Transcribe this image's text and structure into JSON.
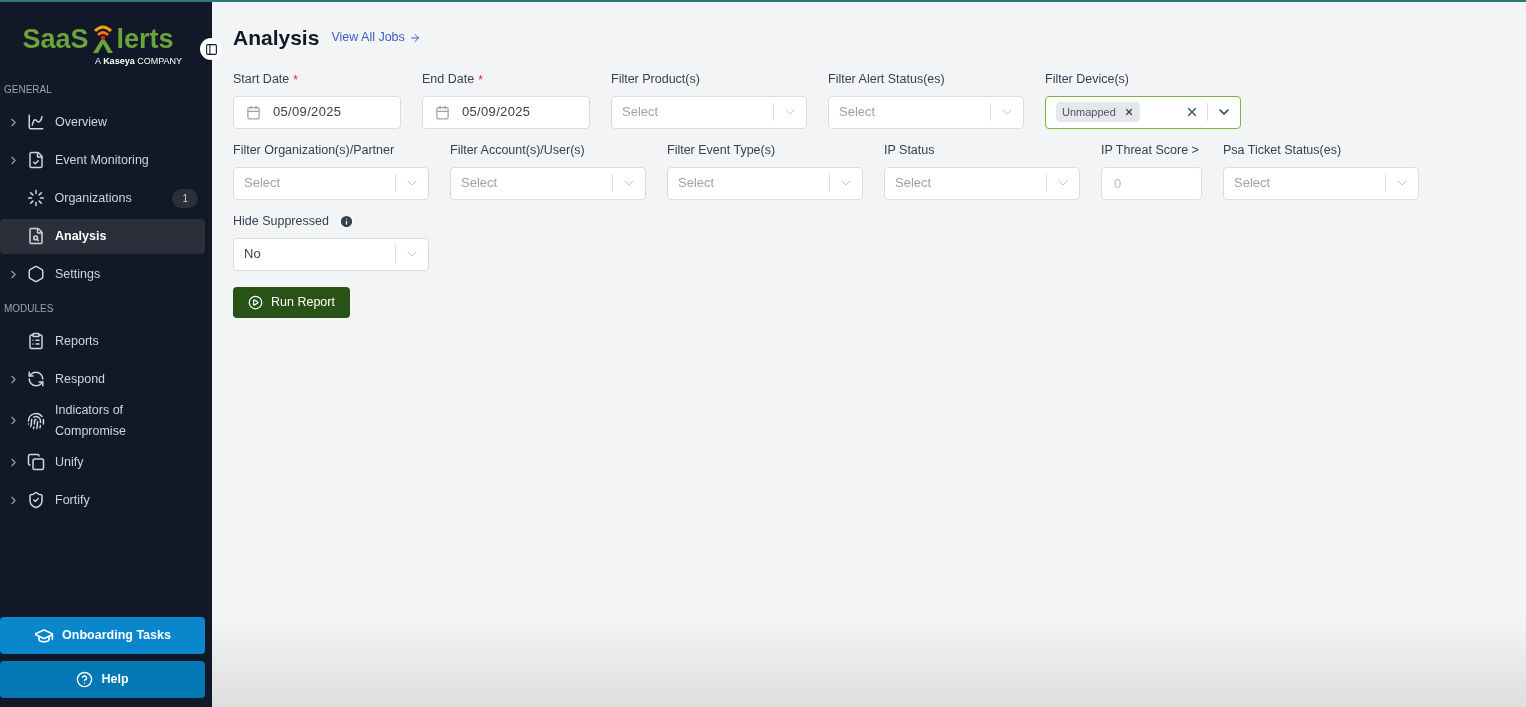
{
  "logo": {
    "left": "SaaS",
    "right": "lerts",
    "tagline": "A **Kaseya** COMPANY"
  },
  "sidebar": {
    "sections": [
      {
        "title": "GENERAL",
        "items": [
          {
            "label": "Overview",
            "expandable": true,
            "selected": false
          },
          {
            "label": "Event Monitoring",
            "expandable": true,
            "selected": false
          },
          {
            "label": "Organizations",
            "expandable": false,
            "selected": false,
            "badge": "1"
          },
          {
            "label": "Analysis",
            "expandable": false,
            "selected": true
          },
          {
            "label": "Settings",
            "expandable": true,
            "selected": false
          }
        ]
      },
      {
        "title": "MODULES",
        "items": [
          {
            "label": "Reports",
            "expandable": false,
            "selected": false
          },
          {
            "label": "Respond",
            "expandable": true,
            "selected": false
          },
          {
            "label": "Indicators of Compromise",
            "expandable": true,
            "selected": false
          },
          {
            "label": "Unify",
            "expandable": true,
            "selected": false
          },
          {
            "label": "Fortify",
            "expandable": true,
            "selected": false
          }
        ]
      }
    ],
    "buttons": [
      {
        "label": "Onboarding Tasks"
      },
      {
        "label": "Help"
      }
    ]
  },
  "page": {
    "title": "Analysis",
    "link": "View All Jobs"
  },
  "filters": [
    [
      {
        "kind": "date",
        "label": "Start Date",
        "required_mark": "*",
        "value": "05/09/2025"
      },
      {
        "kind": "date",
        "label": "End Date",
        "required_mark": "*",
        "value": "05/09/2025"
      },
      {
        "kind": "select",
        "label": "Filter Product(s)",
        "placeholder": "Select"
      },
      {
        "kind": "select",
        "label": "Filter Alert Status(es)",
        "placeholder": "Select"
      },
      {
        "kind": "select",
        "label": "Filter Device(s)",
        "focused": true,
        "tags": [
          "Unmapped"
        ]
      }
    ],
    [
      {
        "kind": "select",
        "label": "Filter Organization(s)/Partner",
        "placeholder": "Select"
      },
      {
        "kind": "select",
        "label": "Filter Account(s)/User(s)",
        "placeholder": "Select"
      },
      {
        "kind": "select",
        "label": "Filter Event Type(s)",
        "placeholder": "Select"
      },
      {
        "kind": "select",
        "label": "IP Status",
        "placeholder": "Select"
      },
      {
        "kind": "number",
        "label": "IP Threat Score >",
        "placeholder": "0"
      },
      {
        "kind": "select",
        "label": "Psa Ticket Status(es)",
        "placeholder": "Select"
      }
    ],
    [
      {
        "kind": "select",
        "label": "Hide Suppressed",
        "info": true,
        "value": "No"
      }
    ]
  ],
  "run_button": "Run Report"
}
